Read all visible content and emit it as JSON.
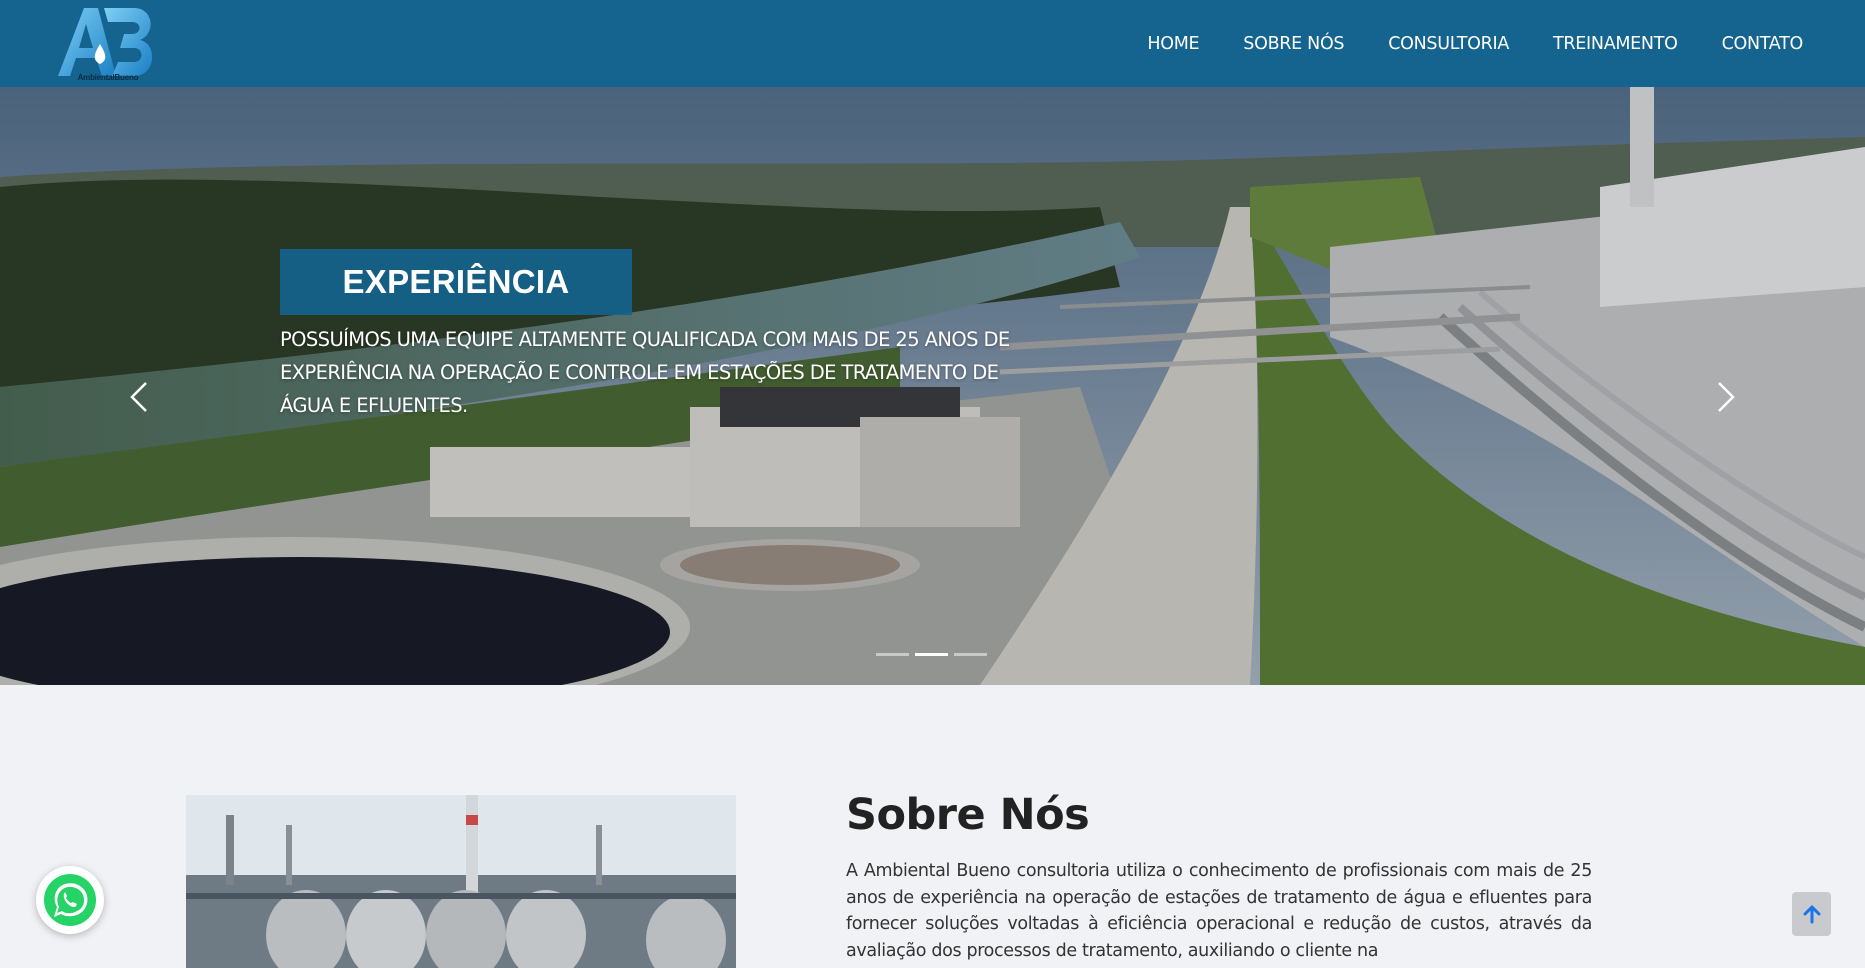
{
  "brand": {
    "logo_initials": "AB",
    "logo_text": "AmbientalBueno",
    "color": "#14648f"
  },
  "nav": {
    "items": [
      {
        "label": "HOME"
      },
      {
        "label": "SOBRE NÓS"
      },
      {
        "label": "CONSULTORIA"
      },
      {
        "label": "TREINAMENTO"
      },
      {
        "label": "CONTATO"
      }
    ]
  },
  "hero": {
    "title": "EXPERIÊNCIA",
    "text": "Possuímos uma equipe altamente qualificada com mais de 25 anos de experiência na operação e controle em estações de tratamento de água e efluentes.",
    "slides_count": 3,
    "active_slide": 1,
    "prev_icon": "chevron-left-icon",
    "next_icon": "chevron-right-icon"
  },
  "about": {
    "title": "Sobre Nós",
    "text": "A Ambiental Bueno consultoria utiliza o conhecimento de profissionais com mais de 25 anos de experiência na operação de estações de tratamento de água e efluentes para fornecer soluções voltadas à eficiência operacional e redução de custos, através da avaliação dos processos de tratamento, auxiliando o cliente na"
  },
  "widgets": {
    "whatsapp_icon": "whatsapp-icon",
    "back_to_top_icon": "arrow-up-icon"
  }
}
